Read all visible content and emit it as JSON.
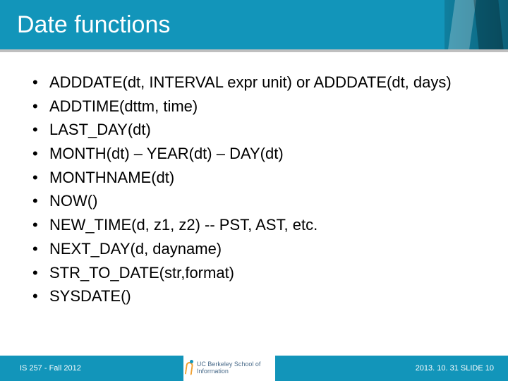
{
  "header": {
    "title": "Date functions"
  },
  "bullets": [
    "ADDDATE(dt, INTERVAL expr unit) or ADDDATE(dt, days)",
    "ADDTIME(dttm, time)",
    "LAST_DAY(dt)",
    "MONTH(dt) – YEAR(dt) – DAY(dt)",
    "MONTHNAME(dt)",
    "NOW()",
    "NEW_TIME(d, z1, z2) -- PST, AST, etc.",
    "NEXT_DAY(d, dayname)",
    "STR_TO_DATE(str,format)",
    "SYSDATE()"
  ],
  "footer": {
    "left": "IS 257 - Fall 2012",
    "brand": "UC Berkeley School of Information",
    "right": "2013. 10. 31 SLIDE 10"
  }
}
